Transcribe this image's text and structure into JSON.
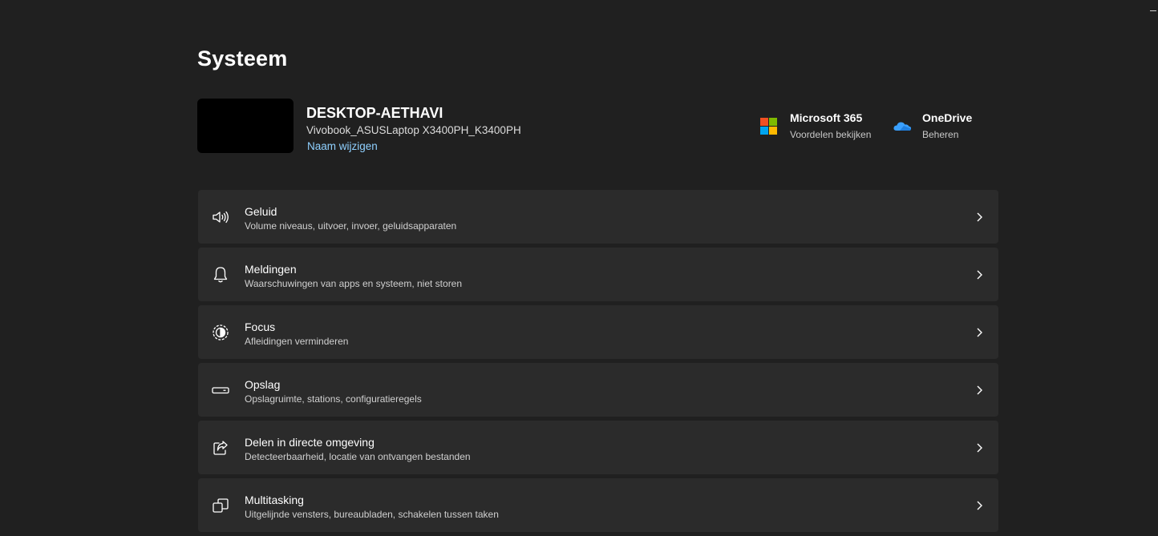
{
  "window": {
    "minimize_glyph": "—"
  },
  "page": {
    "title": "Systeem"
  },
  "device": {
    "name": "DESKTOP-AETHAVI",
    "model": "Vivobook_ASUSLaptop X3400PH_K3400PH",
    "rename_link": "Naam wijzigen"
  },
  "services": [
    {
      "title": "Microsoft 365",
      "subtitle": "Voordelen bekijken",
      "icon": "microsoft-365-icon",
      "colors": [
        "#f25022",
        "#7fba00",
        "#00a4ef",
        "#ffb900"
      ]
    },
    {
      "title": "OneDrive",
      "subtitle": "Beheren",
      "icon": "onedrive-icon",
      "colors": [
        "#3aa0ff"
      ]
    }
  ],
  "settings": [
    {
      "title": "Geluid",
      "description": "Volume niveaus, uitvoer, invoer, geluidsapparaten",
      "icon": "speaker-icon"
    },
    {
      "title": "Meldingen",
      "description": "Waarschuwingen van apps en systeem, niet storen",
      "icon": "bell-icon"
    },
    {
      "title": "Focus",
      "description": "Afleidingen verminderen",
      "icon": "focus-icon"
    },
    {
      "title": "Opslag",
      "description": "Opslagruimte, stations, configuratieregels",
      "icon": "storage-drive-icon"
    },
    {
      "title": "Delen in directe omgeving",
      "description": "Detecteerbaarheid, locatie van ontvangen bestanden",
      "icon": "share-icon"
    },
    {
      "title": "Multitasking",
      "description": "Uitgelijnde vensters, bureaubladen, schakelen tussen taken",
      "icon": "multitasking-icon"
    }
  ],
  "colors": {
    "background": "#202020",
    "card": "#2b2b2b",
    "link": "#8fd0ff",
    "text": "#ffffff",
    "secondary_text": "#d0d0d0"
  }
}
